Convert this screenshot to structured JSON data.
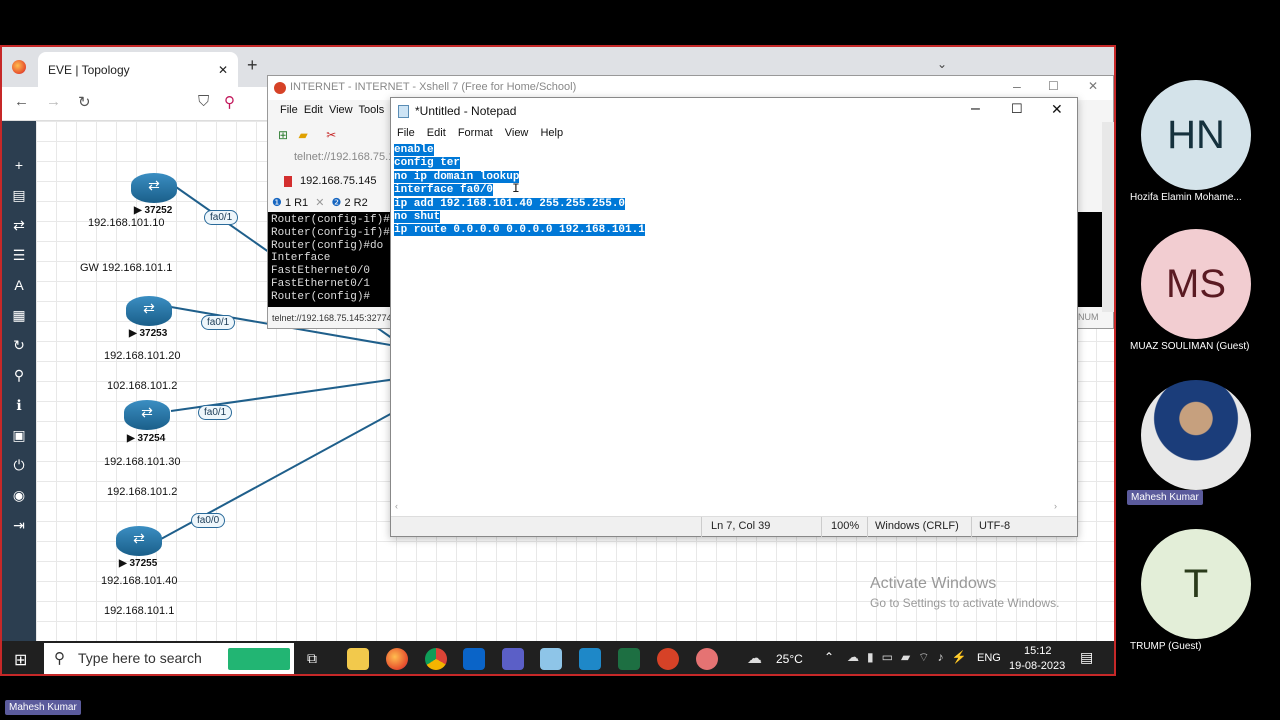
{
  "browser": {
    "tab_title": "EVE | Topology",
    "tab_close": "✕",
    "new_tab": "+"
  },
  "topology": {
    "routers": [
      {
        "id": "37252",
        "ip": "192.168.101.10",
        "gw": "GW 192.168.101.1",
        "iface": "fa0/1"
      },
      {
        "id": "37253",
        "ip": "192.168.101.20",
        "gw": "102.168.101.2",
        "iface": "fa0/1"
      },
      {
        "id": "37254",
        "ip": "192.168.101.30",
        "gw": "192.168.101.2",
        "iface": "fa0/1"
      },
      {
        "id": "37255",
        "ip": "192.168.101.40",
        "gw": "192.168.101.1",
        "iface": "fa0/0"
      }
    ],
    "play_prefix": "▶"
  },
  "xshell": {
    "title": "INTERNET - INTERNET - Xshell 7 (Free for Home/School)",
    "menu": [
      "File",
      "Edit",
      "View",
      "Tools"
    ],
    "address1": "telnet://192.168.75.1",
    "address2": "192.168.75.145",
    "tab1": "1 R1",
    "tab2": "2 R2",
    "terminal_lines": [
      "Router(config-if)#",
      "Router(config-if)#e",
      "Router(config)#do s",
      "Interface",
      "FastEthernet0/0",
      "FastEthernet0/1",
      "Router(config)#"
    ],
    "status": "telnet://192.168.75.145:32774",
    "num_indicator": "NUM"
  },
  "notepad": {
    "title": "*Untitled - Notepad",
    "menu": [
      "File",
      "Edit",
      "Format",
      "View",
      "Help"
    ],
    "lines": [
      "enable",
      "config ter",
      "no ip domain lookup",
      "interface fa0/0",
      "ip add 192.168.101.40 255.255.255.0",
      "no shut",
      "ip route 0.0.0.0 0.0.0.0 192.168.101.1"
    ],
    "status": {
      "position": "Ln 7, Col 39",
      "zoom": "100%",
      "eol": "Windows (CRLF)",
      "encoding": "UTF-8"
    }
  },
  "watermark": {
    "title": "Activate Windows",
    "subtitle": "Go to Settings to activate Windows."
  },
  "taskbar": {
    "search_placeholder": "Type here to search",
    "weather": "25°C",
    "language": "ENG",
    "time": "15:12",
    "date": "19-08-2023"
  },
  "participants": [
    {
      "initials": "HN",
      "name": "Hozifa Elamin Mohame...",
      "bg": "#d4e3ea",
      "fg": "#15313d"
    },
    {
      "initials": "MS",
      "name": "MUAZ SOULIMAN (Guest)",
      "bg": "#f2cdd1",
      "fg": "#5a1a22"
    },
    {
      "initials": "",
      "name": "Mahesh Kumar",
      "bg": "#3a4a5a",
      "fg": "#ffffff"
    },
    {
      "initials": "T",
      "name": "TRUMP (Guest)",
      "bg": "#e3eed8",
      "fg": "#2a3a1a"
    }
  ],
  "presenter_tag": "Mahesh Kumar"
}
